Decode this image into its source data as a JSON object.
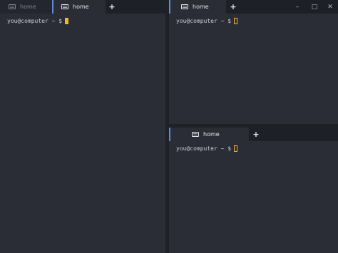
{
  "panes": {
    "left": {
      "tabs": [
        {
          "label": "home",
          "icon": "keyboard-icon",
          "state": "inactive"
        },
        {
          "label": "home",
          "icon": "keyboard-icon",
          "state": "active"
        }
      ],
      "add_tab": "+",
      "prompt": "you@computer ~ $",
      "cursor": "filled"
    },
    "top_right": {
      "tabs": [
        {
          "label": "home",
          "icon": "keyboard-icon",
          "state": "active"
        }
      ],
      "add_tab": "+",
      "prompt": "you@computer ~ $",
      "cursor": "outline"
    },
    "bottom_right": {
      "tabs": [
        {
          "label": "home",
          "icon": "keyboard-icon",
          "state": "active"
        }
      ],
      "add_tab": "+",
      "prompt": "you@computer ~ $",
      "cursor": "outline"
    }
  },
  "window_controls": {
    "minimize": "–",
    "maximize": "□",
    "close": "✕"
  },
  "colors": {
    "background": "#2a2d36",
    "tabbar": "#1e2027",
    "active_tab_indicator": "#5e8ad6",
    "cursor": "#f3b81b",
    "text": "#c9ccd3"
  }
}
